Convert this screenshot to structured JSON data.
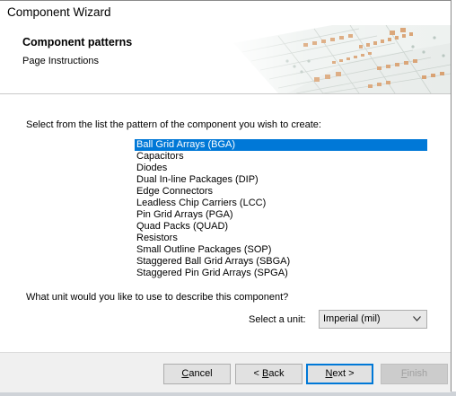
{
  "window": {
    "title": "Component Wizard"
  },
  "header": {
    "title": "Component patterns",
    "subtitle": "Page Instructions"
  },
  "main": {
    "instruction": "Select from the list the pattern of the component you wish to create:",
    "patterns": [
      "Ball Grid Arrays (BGA)",
      "Capacitors",
      "Diodes",
      "Dual In-line Packages (DIP)",
      "Edge Connectors",
      "Leadless Chip Carriers (LCC)",
      "Pin Grid Arrays (PGA)",
      "Quad Packs (QUAD)",
      "Resistors",
      "Small Outline Packages (SOP)",
      "Staggered Ball Grid Arrays (SBGA)",
      "Staggered Pin Grid Arrays (SPGA)"
    ],
    "selected_pattern": "Ball Grid Arrays (BGA)",
    "unit_question": "What unit would you like to use to describe this component?",
    "unit_label": "Select a unit:",
    "unit_value": "Imperial (mil)"
  },
  "buttons": {
    "cancel": {
      "pre": "",
      "key": "C",
      "post": "ancel"
    },
    "back": {
      "pre": "< ",
      "key": "B",
      "post": "ack"
    },
    "next": {
      "pre": "",
      "key": "N",
      "post": "ext >"
    },
    "finish": {
      "pre": "",
      "key": "F",
      "post": "inish"
    }
  },
  "colors": {
    "selection": "#0078d7",
    "dialog_bg": "#f0f0f0",
    "pcb_pad": "#d8a070"
  },
  "icons": [
    "pcb-artwork",
    "chevron-down-icon"
  ]
}
